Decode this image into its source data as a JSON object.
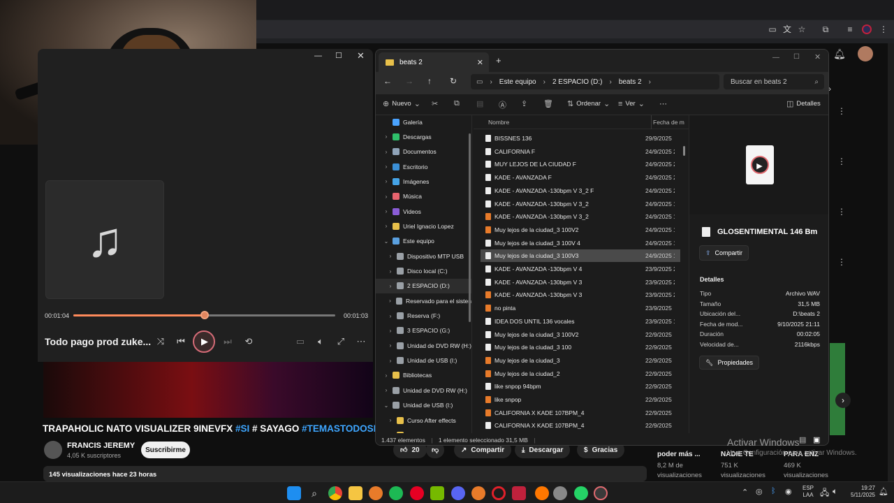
{
  "explorer": {
    "tab_title": "beats 2",
    "breadcrumb": [
      "Este equipo",
      "2 ESPACIO (D:)",
      "beats 2"
    ],
    "search_placeholder": "Buscar en beats 2",
    "toolbar": {
      "new_label": "Nuevo",
      "sort_label": "Ordenar",
      "view_label": "Ver",
      "details_label": "Detalles"
    },
    "columns": {
      "name": "Nombre",
      "date": "Fecha de m"
    },
    "nav_items": [
      {
        "label": "Galería",
        "indent": 1,
        "color": "#4aa3ff",
        "chev": ""
      },
      {
        "label": "Descargas",
        "indent": 1,
        "color": "#2fbf6a",
        "chev": "›"
      },
      {
        "label": "Documentos",
        "indent": 1,
        "color": "#8fa3b8",
        "chev": "›"
      },
      {
        "label": "Escritorio",
        "indent": 1,
        "color": "#3b8fd6",
        "chev": "›"
      },
      {
        "label": "Imágenes",
        "indent": 1,
        "color": "#45a4e8",
        "chev": "›"
      },
      {
        "label": "Música",
        "indent": 1,
        "color": "#e8646e",
        "chev": "›"
      },
      {
        "label": "Videos",
        "indent": 1,
        "color": "#8a5cd6",
        "chev": "›"
      },
      {
        "label": "Uriel Ignacio Lopez",
        "indent": 1,
        "color": "#e8c04a",
        "chev": "›"
      },
      {
        "label": "Este equipo",
        "indent": 1,
        "color": "#5aa0e0",
        "chev": "⌄"
      },
      {
        "label": "Dispositivo MTP USB",
        "indent": 2,
        "color": "#9aa0a6",
        "chev": "›"
      },
      {
        "label": "Disco local (C:)",
        "indent": 2,
        "color": "#9aa0a6",
        "chev": "›"
      },
      {
        "label": "2 ESPACIO (D:)",
        "indent": 2,
        "color": "#9aa0a6",
        "chev": "›",
        "selected": true
      },
      {
        "label": "Reservado para el sisten",
        "indent": 2,
        "color": "#9aa0a6",
        "chev": "›"
      },
      {
        "label": "Reserva (F:)",
        "indent": 2,
        "color": "#9aa0a6",
        "chev": "›"
      },
      {
        "label": "3 ESPACIO (G:)",
        "indent": 2,
        "color": "#9aa0a6",
        "chev": "›"
      },
      {
        "label": "Unidad de DVD RW (H:)",
        "indent": 2,
        "color": "#9aa0a6",
        "chev": "›"
      },
      {
        "label": "Unidad de USB (I:)",
        "indent": 2,
        "color": "#9aa0a6",
        "chev": "›"
      },
      {
        "label": "Bibliotecas",
        "indent": 1,
        "color": "#e8c04a",
        "chev": "›"
      },
      {
        "label": "Unidad de DVD RW (H:)",
        "indent": 1,
        "color": "#9aa0a6",
        "chev": "›"
      },
      {
        "label": "Unidad de USB (I:)",
        "indent": 1,
        "color": "#9aa0a6",
        "chev": "⌄"
      },
      {
        "label": "Curso After effects",
        "indent": 2,
        "color": "#e8c04a",
        "chev": "›"
      },
      {
        "label": "Curso Davinci Resolve -",
        "indent": 2,
        "color": "#e8c04a",
        "chev": "›"
      }
    ],
    "files": [
      {
        "name": "BISSNES 136",
        "date": "29/9/2025",
        "kind": "wav"
      },
      {
        "name": "CALIFORNIA F",
        "date": "24/9/2025 2",
        "kind": "wav"
      },
      {
        "name": "MUY LEJOS DE LA CIUDAD F",
        "date": "24/9/2025 2",
        "kind": "wav"
      },
      {
        "name": "KADE - AVANZADA F",
        "date": "24/9/2025 2",
        "kind": "wav"
      },
      {
        "name": "KADE - AVANZADA -130bpm V 3_2 F",
        "date": "24/9/2025 2",
        "kind": "wav"
      },
      {
        "name": "KADE - AVANZADA -130bpm V 3_2",
        "date": "24/9/2025 1",
        "kind": "wav"
      },
      {
        "name": "KADE - AVANZADA -130bpm V 3_2",
        "date": "24/9/2025 1",
        "kind": "flp"
      },
      {
        "name": "Muy lejos de la ciudad_3 100V2",
        "date": "24/9/2025 1",
        "kind": "flp"
      },
      {
        "name": "Muy lejos de la ciudad_3 100V 4",
        "date": "24/9/2025 1",
        "kind": "wav"
      },
      {
        "name": "Muy lejos de la ciudad_3 100V3",
        "date": "24/9/2025 1",
        "kind": "wav",
        "selected": true
      },
      {
        "name": "KADE - AVANZADA -130bpm V 4",
        "date": "23/9/2025 2",
        "kind": "wav"
      },
      {
        "name": "KADE - AVANZADA -130bpm V 3",
        "date": "23/9/2025 2",
        "kind": "wav"
      },
      {
        "name": "KADE - AVANZADA -130bpm V 3",
        "date": "23/9/2025 2",
        "kind": "flp"
      },
      {
        "name": "no pinta",
        "date": "23/9/2025",
        "kind": "flp"
      },
      {
        "name": "IDEA DOS UNTIL 136 vocales",
        "date": "23/9/2025 1",
        "kind": "wav"
      },
      {
        "name": "Muy lejos de la ciudad_3 100V2",
        "date": "22/9/2025",
        "kind": "wav"
      },
      {
        "name": "Muy lejos de la ciudad_3 100",
        "date": "22/9/2025",
        "kind": "wav"
      },
      {
        "name": "Muy lejos de la ciudad_3",
        "date": "22/9/2025",
        "kind": "flp"
      },
      {
        "name": "Muy lejos de la ciudad_2",
        "date": "22/9/2025",
        "kind": "flp"
      },
      {
        "name": "like snpop 94bpm",
        "date": "22/9/2025",
        "kind": "wav"
      },
      {
        "name": "like snpop",
        "date": "22/9/2025",
        "kind": "flp"
      },
      {
        "name": "CALIFORNIA X KADE 107BPM_4",
        "date": "22/9/2025",
        "kind": "flp"
      },
      {
        "name": "CALIFORNIA X KADE 107BPM_4",
        "date": "22/9/2025",
        "kind": "wav"
      }
    ],
    "details": {
      "file_title": "GLOSENTIMENTAL 146 Bm",
      "share_label": "Compartir",
      "section_label": "Detalles",
      "rows": [
        {
          "k": "Tipo",
          "v": "Archivo WAV"
        },
        {
          "k": "Tamaño",
          "v": "31,5 MB"
        },
        {
          "k": "Ubicación del...",
          "v": "D:\\beats 2"
        },
        {
          "k": "Fecha de mod...",
          "v": "9/10/2025 21:11"
        },
        {
          "k": "Duración",
          "v": "00:02:05"
        },
        {
          "k": "Velocidad de...",
          "v": "2116kbps"
        }
      ],
      "properties_label": "Propiedades"
    },
    "status": {
      "count": "1.437 elementos",
      "selected": "1 elemento seleccionado  31,5 MB"
    }
  },
  "media_player": {
    "elapsed": "00:01:04",
    "total": "00:01:03",
    "progress": 0.5,
    "track_title": "Todo pago prod zuke..."
  },
  "youtube": {
    "title_plain": "TRAPAHOLIC NATO VISUALIZER 9INEVFX ",
    "title_tag1": "#SI",
    "title_mid": " # SAYAGO ",
    "title_tag2": "#TEMASTODOSLOSD",
    "channel": "FRANCIS JEREMY",
    "subs": "4,05 K suscriptores",
    "subscribe": "Suscribirme",
    "likes": "20",
    "share": "Compartir",
    "download": "Descargar",
    "thanks": "Gracias",
    "views_line": "145 visualizaciones  hace 23 horas",
    "side_cards": [
      {
        "title": "poder más ...",
        "meta1": "8,2 M de",
        "meta2": "visualizaciones"
      },
      {
        "title": "NADIE TE",
        "meta1": "751 K",
        "meta2": "visualizaciones"
      },
      {
        "title": "PARA ENZ",
        "meta1": "469 K",
        "meta2": "visualizaciones"
      }
    ]
  },
  "watermark": {
    "line1": "Activar Windows",
    "line2": "Ve a Configuración para activar Windows."
  },
  "system_tray": {
    "lang1": "ESP",
    "lang2": "LAA",
    "time": "19:27",
    "date": "5/11/2025"
  },
  "colors": {
    "accent": "#ff8a5b",
    "yt_link": "#3ea6ff",
    "folder": "#e8c04a"
  }
}
